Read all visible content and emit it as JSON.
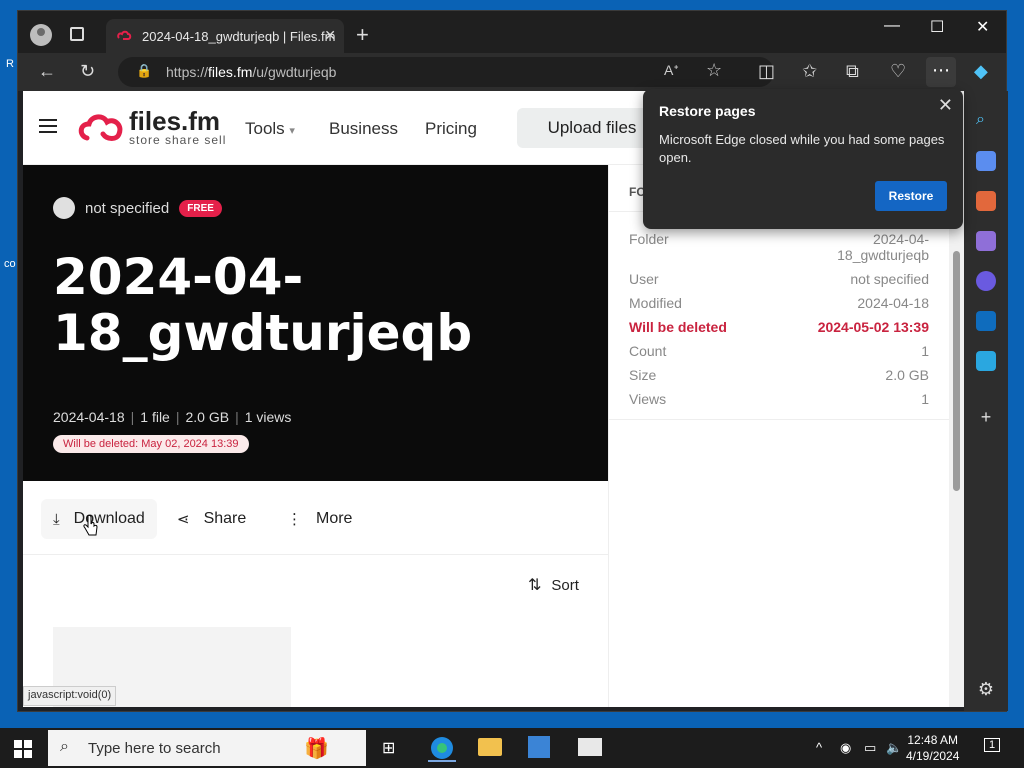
{
  "browser": {
    "tab_title": "2024-04-18_gwdturjeqb | Files.fm",
    "url_prefix": "https://",
    "url_host": "files.fm",
    "url_path": "/u/gwdturjeqb",
    "status_text": "javascript:void(0)"
  },
  "site": {
    "logo_name": "files.fm",
    "logo_tagline": "store share sell",
    "nav": [
      "Tools",
      "Business",
      "Pricing"
    ],
    "upload_label": "Upload files"
  },
  "hero": {
    "owner": "not specified",
    "badge": "FREE",
    "title": "2024-04-18_gwdturjeqb",
    "meta": [
      "2024-04-18",
      "1 file",
      "2.0 GB",
      "1 views"
    ],
    "warning": "Will be deleted: May 02, 2024 13:39"
  },
  "actions": {
    "download": "Download",
    "share": "Share",
    "more": "More",
    "sort": "Sort"
  },
  "details": {
    "heading": "FO",
    "rows": [
      {
        "label": "Folder",
        "value": "2024-04-18_gwdturjeqb"
      },
      {
        "label": "User",
        "value": "not specified"
      },
      {
        "label": "Modified",
        "value": "2024-04-18"
      },
      {
        "label": "Will be deleted",
        "value": "2024-05-02 13:39"
      },
      {
        "label": "Count",
        "value": "1"
      },
      {
        "label": "Size",
        "value": "2.0 GB"
      },
      {
        "label": "Views",
        "value": "1"
      }
    ]
  },
  "popup": {
    "title": "Restore pages",
    "message": "Microsoft Edge closed while you had some pages open.",
    "button": "Restore"
  },
  "taskbar": {
    "search_placeholder": "Type here to search",
    "time": "12:48 AM",
    "date": "4/19/2024",
    "notifications": "1"
  },
  "colors": {
    "accent": "#e4204a",
    "edge_blue": "#1466c4",
    "hero_bg": "#0b0b0b"
  }
}
